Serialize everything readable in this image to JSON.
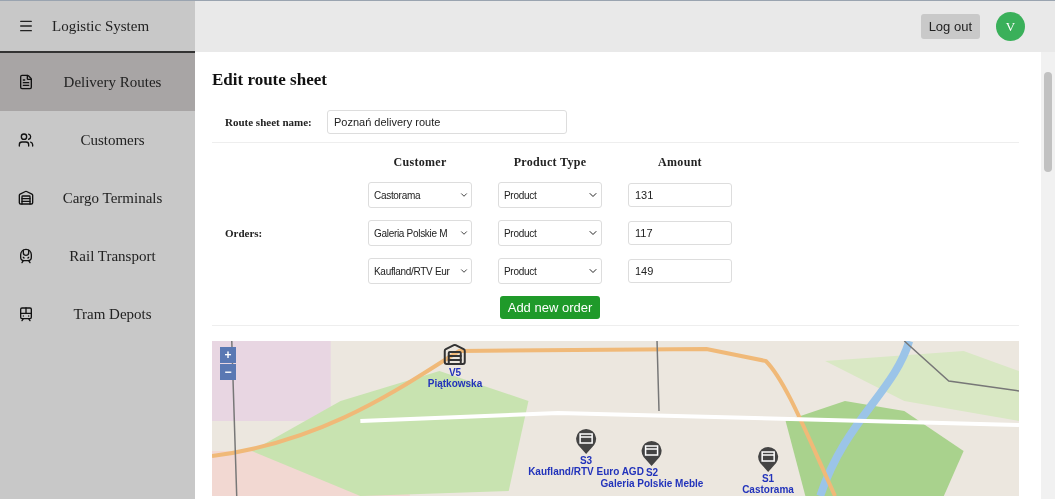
{
  "sidebar": {
    "title": "Logistic System",
    "items": [
      {
        "label": "Delivery Routes",
        "selected": true
      },
      {
        "label": "Customers",
        "selected": false
      },
      {
        "label": "Cargo Terminals",
        "selected": false
      },
      {
        "label": "Rail Transport",
        "selected": false
      },
      {
        "label": "Tram Depots",
        "selected": false
      }
    ]
  },
  "topbar": {
    "logout": "Log out",
    "avatar": "V"
  },
  "page_title": "Edit route sheet",
  "form": {
    "name_label": "Route sheet name:",
    "name_value": "Poznań delivery route",
    "orders_label": "Orders:",
    "columns": [
      "Customer",
      "Product Type",
      "Amount"
    ],
    "orders": [
      {
        "customer": "Castorama",
        "product_type": "Product",
        "amount": "131"
      },
      {
        "customer": "Galeria Polskie M",
        "product_type": "Product",
        "amount": "117"
      },
      {
        "customer": "Kaufland/RTV Eur",
        "product_type": "Product",
        "amount": "149"
      }
    ],
    "add_button": "Add new order"
  },
  "map": {
    "zoom_in": "+",
    "zoom_out": "−",
    "markers": [
      {
        "kind": "warehouse",
        "code": "V5",
        "name": "Piątkowska"
      },
      {
        "kind": "shop",
        "code": "S3",
        "name": "Kaufland/RTV Euro AGD"
      },
      {
        "kind": "shop",
        "code": "S2",
        "name": "Galeria Polskie Meble"
      },
      {
        "kind": "shop",
        "code": "S1",
        "name": "Castorama"
      }
    ]
  }
}
